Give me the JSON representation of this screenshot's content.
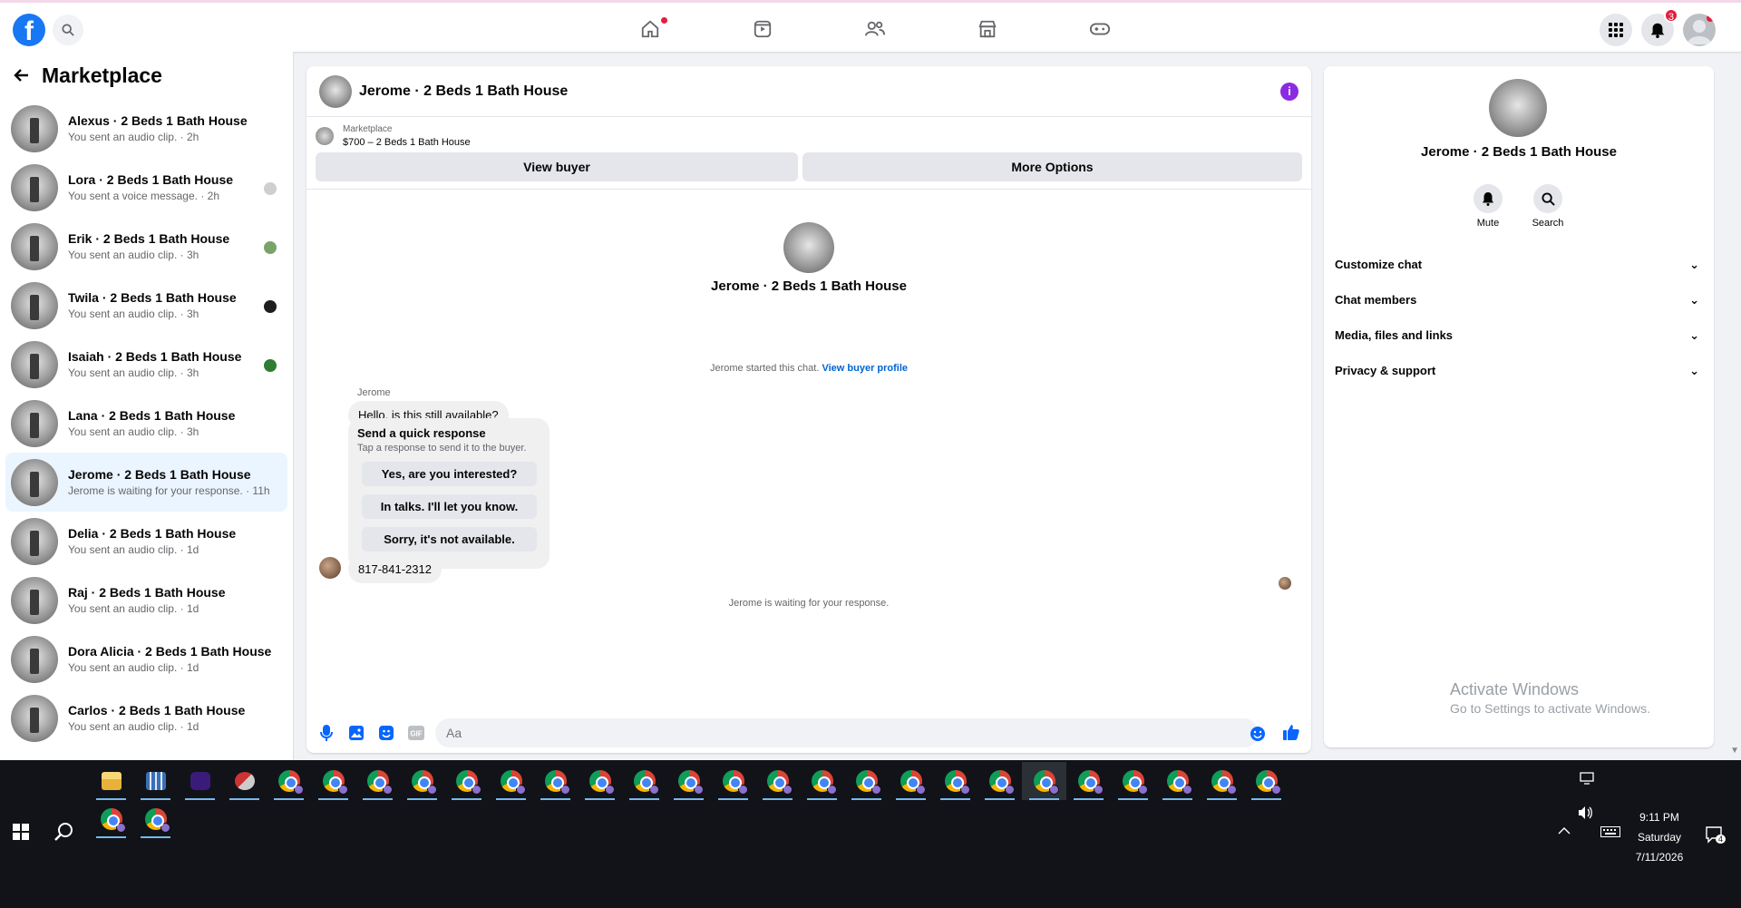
{
  "topbar": {
    "logo": "f",
    "notifications_count": "3",
    "nav_icons": [
      "home-icon",
      "watch-icon",
      "friends-icon",
      "marketplace-icon",
      "gaming-icon"
    ]
  },
  "sidebar": {
    "title": "Marketplace",
    "conversations": [
      {
        "name": "Alexus · 2 Beds 1 Bath House",
        "sub": "You sent an audio clip. · 2h"
      },
      {
        "name": "Lora · 2 Beds 1 Bath House",
        "sub": "You sent a voice message. · 2h"
      },
      {
        "name": "Erik · 2 Beds 1 Bath House",
        "sub": "You sent an audio clip. · 3h"
      },
      {
        "name": "Twila · 2 Beds 1 Bath House",
        "sub": "You sent an audio clip. · 3h"
      },
      {
        "name": "Isaiah · 2 Beds 1 Bath House",
        "sub": "You sent an audio clip. · 3h"
      },
      {
        "name": "Lana · 2 Beds 1 Bath House",
        "sub": "You sent an audio clip. · 3h"
      },
      {
        "name": "Jerome · 2 Beds 1 Bath House",
        "sub": "Jerome is waiting for your response. · 11h"
      },
      {
        "name": "Delia · 2 Beds 1 Bath House",
        "sub": "You sent an audio clip. · 1d"
      },
      {
        "name": "Raj · 2 Beds 1 Bath House",
        "sub": "You sent an audio clip. · 1d"
      },
      {
        "name": "Dora Alicia · 2 Beds 1 Bath House",
        "sub": "You sent an audio clip. · 1d"
      },
      {
        "name": "Carlos · 2 Beds 1 Bath House",
        "sub": "You sent an audio clip. · 1d"
      }
    ]
  },
  "chat": {
    "title": "Jerome · 2 Beds 1 Bath House",
    "marketplace_label": "Marketplace",
    "listing": "$700 – 2 Beds 1 Bath House",
    "view_buyer": "View buyer",
    "more_options": "More Options",
    "intro_name": "Jerome · 2 Beds 1 Bath House",
    "started_text": "Jerome started this chat.",
    "view_profile": "View buyer profile",
    "sender": "Jerome",
    "message1": "Hello, is this still available?",
    "quick_title": "Send a quick response",
    "quick_sub": "Tap a response to send it to the buyer.",
    "quick_options": [
      "Yes, are you interested?",
      "In talks. I'll let you know.",
      "Sorry, it's not available."
    ],
    "message2": "817-841-2312",
    "waiting": "Jerome is waiting for your response.",
    "input_placeholder": "Aa",
    "gif_label": "GIF"
  },
  "details": {
    "name": "Jerome · 2 Beds 1 Bath House",
    "mute": "Mute",
    "search": "Search",
    "sections": [
      "Customize chat",
      "Chat members",
      "Media, files and links",
      "Privacy & support"
    ],
    "activate_title": "Activate Windows",
    "activate_sub": "Go to Settings to activate Windows."
  },
  "taskbar": {
    "time": "9:11 PM",
    "day": "Saturday",
    "date": "7/11/2026",
    "notif_count": "4"
  }
}
